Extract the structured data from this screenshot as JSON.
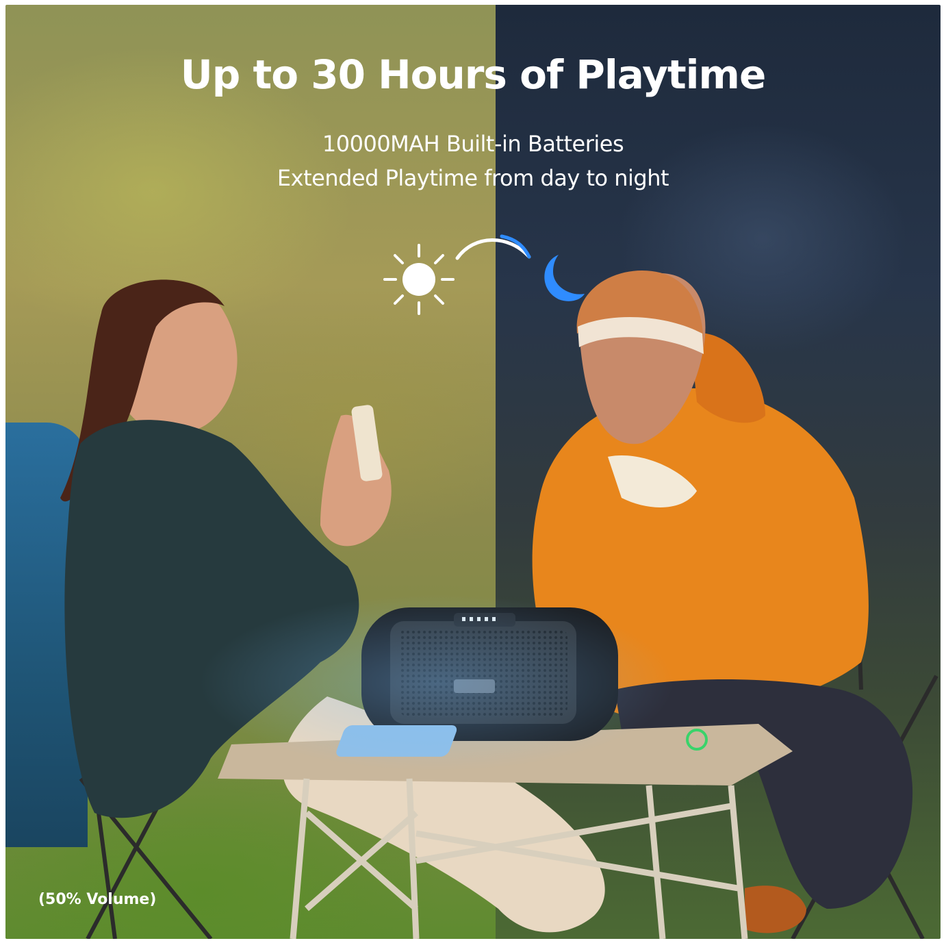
{
  "headline": {
    "title": "Up to 30 Hours of Playtime",
    "line1": "10000MAH Built-in Batteries",
    "line2": "Extended Playtime from day to night"
  },
  "footnote": {
    "volume": "(50% Volume)"
  },
  "icons": {
    "day": "sun-icon",
    "night": "moon-icon",
    "transition": "arc-icon",
    "charging": "wireless-charging-icon"
  },
  "colors": {
    "moon_blue": "#2f8cff",
    "jacket_orange": "#e8861c",
    "text": "#ffffff"
  }
}
